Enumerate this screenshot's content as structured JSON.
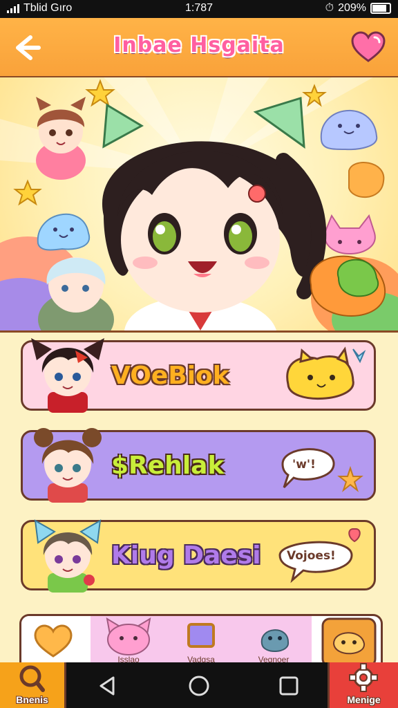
{
  "status_bar": {
    "carrier": "Tblid Gıro",
    "time": "1:787",
    "battery": "209%"
  },
  "app_bar": {
    "title": "Inbae Hsgaita"
  },
  "cards": [
    {
      "label": "VOeBiok",
      "color": "#ffd0e0",
      "text_color": "#ffb020"
    },
    {
      "label": "$Rehlak",
      "color": "#b79cf2",
      "text_color": "#b8e03a",
      "bubble_text": "'w'!"
    },
    {
      "label": "Kiug Daesi",
      "color": "#ffe27a",
      "text_color": "#b07bea",
      "bubble_text": "Vojoes!"
    }
  ],
  "tray": {
    "items": [
      {
        "label": ""
      },
      {
        "label": "Isslao"
      },
      {
        "label": "Vadgsa"
      },
      {
        "label": "Vegnoer"
      }
    ]
  },
  "bottom_nav": {
    "left_label": "Bnenis",
    "right_label": "Menige"
  },
  "colors": {
    "app_bar": "#f9a23a",
    "title": "#ff5fa0",
    "bottom_left": "#f6a21a",
    "bottom_right": "#e8403a"
  },
  "icons": [
    "signal-icon",
    "back-arrow-icon",
    "heart-icon",
    "search-icon",
    "gear-icon",
    "nav-back-icon",
    "nav-home-icon",
    "nav-recents-icon"
  ]
}
